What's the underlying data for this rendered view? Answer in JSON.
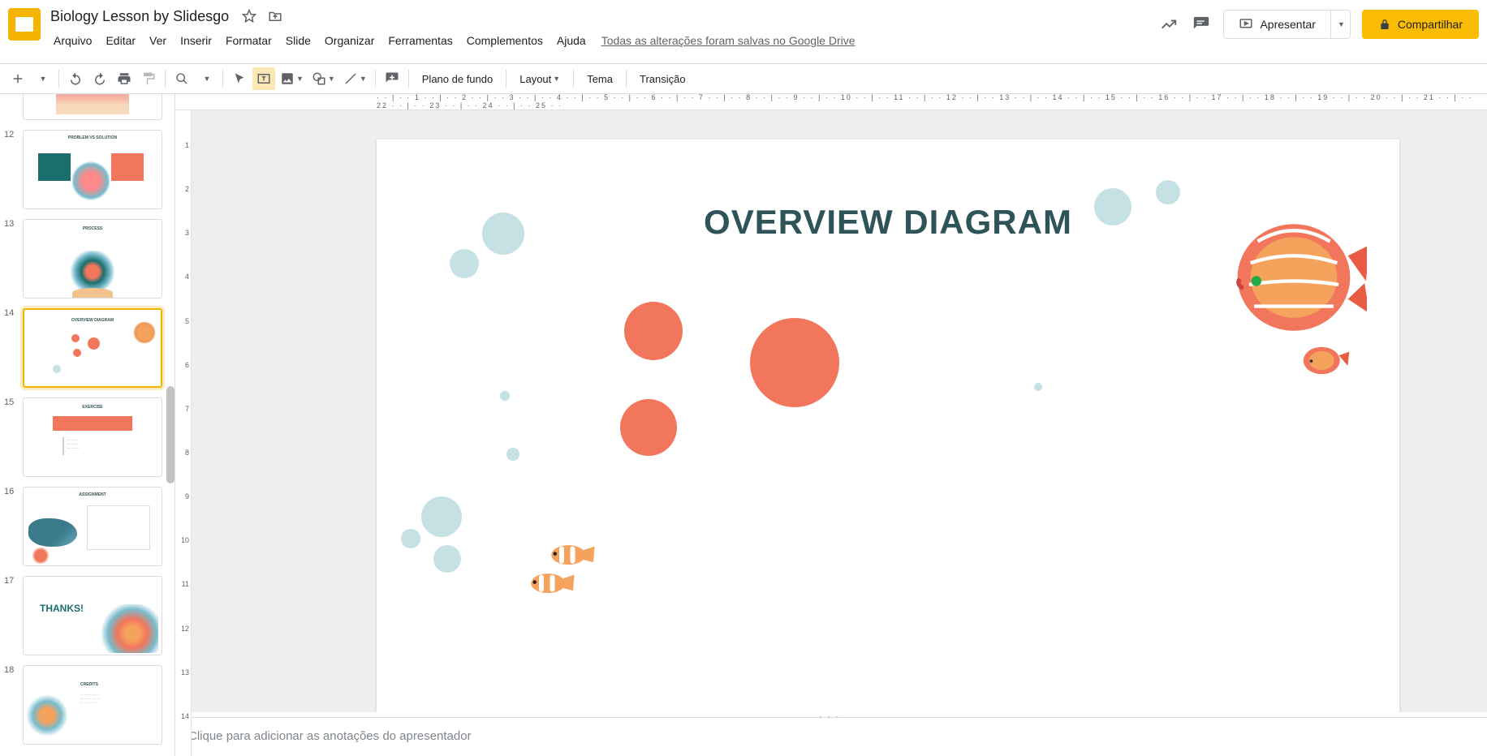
{
  "header": {
    "doc_title": "Biology Lesson by Slidesgo",
    "star_icon": "star-outline",
    "move_icon": "move-folder",
    "present_label": "Apresentar",
    "share_label": "Compartilhar"
  },
  "menus": [
    "Arquivo",
    "Editar",
    "Ver",
    "Inserir",
    "Formatar",
    "Slide",
    "Organizar",
    "Ferramentas",
    "Complementos",
    "Ajuda"
  ],
  "save_status": "Todas as alterações foram salvas no Google Drive",
  "toolbar": {
    "background_label": "Plano de fundo",
    "layout_label": "Layout",
    "theme_label": "Tema",
    "transition_label": "Transição"
  },
  "ruler_h": "· · | · · 1 · · | · · 2 · · | · · 3 · · | · · 4 · · | · · 5 · · | · · 6 · · | · · 7 · · | · · 8 · · | · · 9 · · | · · 10 · · | · · 11 · · | · · 12 · · | · · 13 · · | · · 14 · · | · · 15 · · | · · 16 · · | · · 17 · · | · · 18 · · | · · 19 · · | · · 20 · · | · · 21 · · | · · 22 · · | · · 23 · · | · · 24 · · | · · 25 · ·",
  "ruler_v": [
    "",
    "1",
    "2",
    "3",
    "4",
    "5",
    "6",
    "7",
    "8",
    "9",
    "10",
    "11",
    "12",
    "13",
    "14"
  ],
  "filmstrip": [
    {
      "num": "",
      "selected": false
    },
    {
      "num": "12",
      "selected": false
    },
    {
      "num": "13",
      "selected": false
    },
    {
      "num": "14",
      "selected": true
    },
    {
      "num": "15",
      "selected": false
    },
    {
      "num": "16",
      "selected": false
    },
    {
      "num": "17",
      "selected": false
    },
    {
      "num": "18",
      "selected": false
    }
  ],
  "slide": {
    "title": "OVERVIEW DIAGRAM"
  },
  "notes_placeholder": "Clique para adicionar as anotações do apresentador",
  "thumb_labels": {
    "t12": "PROBLEM VS SOLUTION",
    "t13": "PROCESS",
    "t14": "OVERVIEW DIAGRAM",
    "t15": "EXERCISE",
    "t16": "ASSIGNMENT",
    "t17": "THANKS!",
    "t18": "CREDITS"
  }
}
